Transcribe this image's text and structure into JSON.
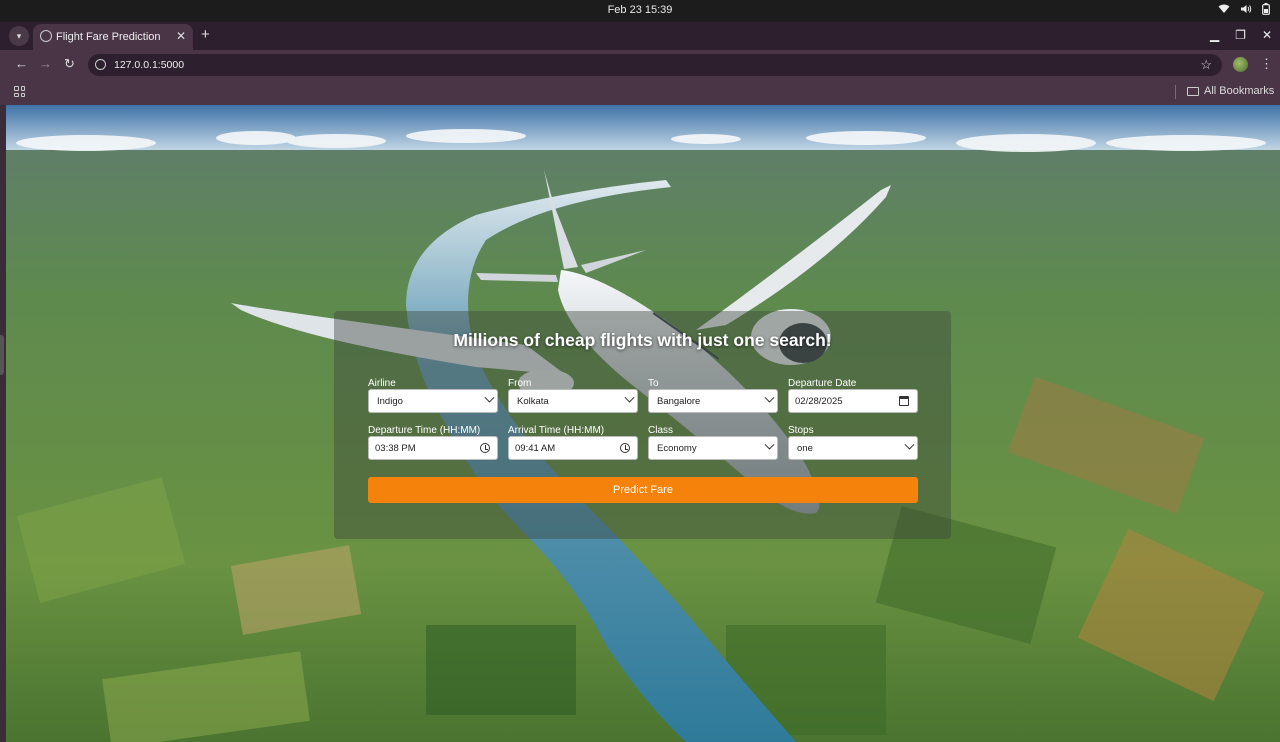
{
  "os": {
    "clock": "Feb 23  15:39",
    "tray_icons": [
      "wifi-icon",
      "volume-icon",
      "battery-icon"
    ]
  },
  "browser": {
    "tab_title": "Flight Fare Prediction",
    "url": "127.0.0.1:5000",
    "bookmarks_label": "All Bookmarks"
  },
  "page": {
    "heading": "Millions of cheap flights with just one search!",
    "fields": {
      "airline": {
        "label": "Airline",
        "value": "Indigo"
      },
      "from": {
        "label": "From",
        "value": "Kolkata"
      },
      "to": {
        "label": "To",
        "value": "Bangalore"
      },
      "departure_date": {
        "label": "Departure Date",
        "value": "02/28/2025"
      },
      "departure_time": {
        "label": "Departure Time (HH:MM)",
        "value": "03:38 PM"
      },
      "arrival_time": {
        "label": "Arrival Time (HH:MM)",
        "value": "09:41 AM"
      },
      "class": {
        "label": "Class",
        "value": "Economy"
      },
      "stops": {
        "label": "Stops",
        "value": "one"
      }
    },
    "submit_label": "Predict Fare"
  },
  "colors": {
    "accent": "#f5820a",
    "tab_strip": "#2d1f2d",
    "toolbar": "#4a3547"
  }
}
